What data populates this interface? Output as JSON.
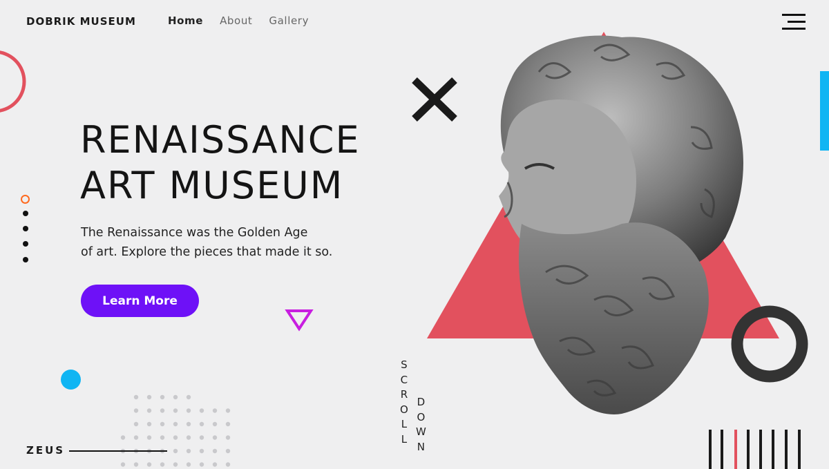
{
  "header": {
    "logo": "DOBRIK MUSEUM",
    "nav": [
      {
        "label": "Home",
        "active": true
      },
      {
        "label": "About",
        "active": false
      },
      {
        "label": "Gallery",
        "active": false
      }
    ],
    "menu_icon": "hamburger-menu-icon"
  },
  "hero": {
    "title_line1": "RENAISSANCE",
    "title_line2": "ART MUSEUM",
    "desc_line1": "The Renaissance was the Golden Age",
    "desc_line2": "of art. Explore the pieces that made it so.",
    "cta_label": "Learn More"
  },
  "slider": {
    "count": 5,
    "active_index": 0
  },
  "scroll": {
    "word1": [
      "S",
      "C",
      "R",
      "O",
      "L",
      "L"
    ],
    "word2": [
      "D",
      "O",
      "W",
      "N"
    ]
  },
  "footer": {
    "caption": "ZEUS"
  },
  "colors": {
    "accent_purple": "#6e11f7",
    "coral": "#e2515e",
    "blue": "#10b5f3",
    "orange": "#ff6a1f",
    "magenta": "#c81ee0",
    "dark": "#333333"
  },
  "decor": {
    "x_mark": "cross-icon",
    "sculpture": "zeus-bust-sculpture"
  }
}
